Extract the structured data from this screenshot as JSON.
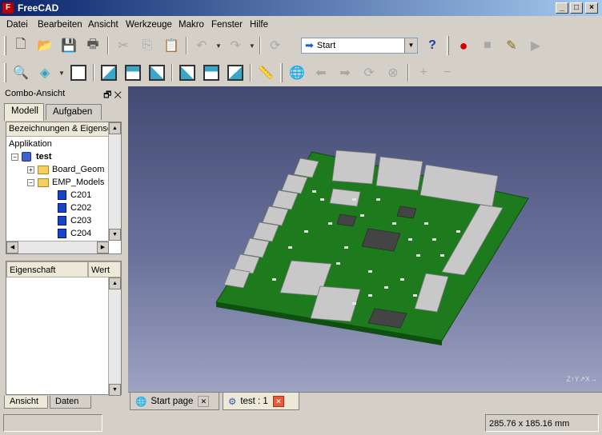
{
  "window": {
    "title": "FreeCAD",
    "app_icon_glyph": "F"
  },
  "menu": [
    "Datei",
    "Bearbeiten",
    "Ansicht",
    "Werkzeuge",
    "Makro",
    "Fenster",
    "Hilfe"
  ],
  "workbench": {
    "selected": "Start"
  },
  "combo": {
    "title": "Combo-Ansicht",
    "tabs": [
      "Modell",
      "Aufgaben"
    ],
    "tree_header": "Bezeichnungen & Eigenscha",
    "tree": {
      "root": "Applikation",
      "doc": "test",
      "folders": [
        "Board_Geom",
        "EMP_Models"
      ],
      "items": [
        "C201",
        "C202",
        "C203",
        "C204"
      ]
    },
    "props_header": [
      "Eigenschaft",
      "Wert"
    ],
    "bottom_tabs": [
      "Ansicht",
      "Daten"
    ]
  },
  "doc_tabs": [
    "Start page",
    "test : 1"
  ],
  "status": {
    "dimensions": "285.76 x 185.16 mm"
  },
  "colors": {
    "pcb": "#1d7a1d",
    "viewport_top": "#424a73",
    "viewport_bottom": "#9ea3c2",
    "record": "#d40000"
  }
}
